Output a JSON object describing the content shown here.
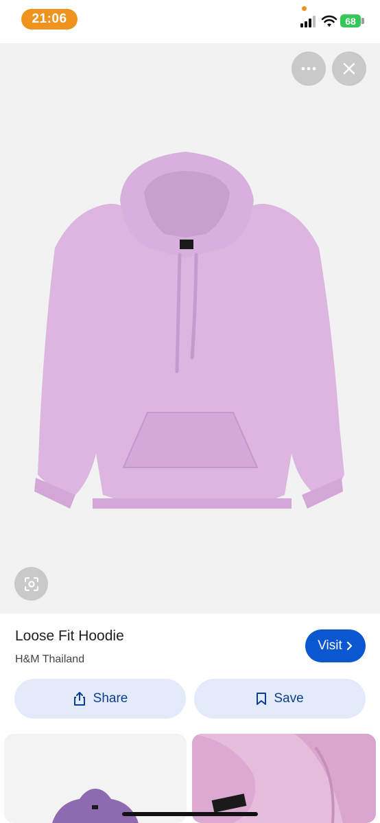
{
  "status_bar": {
    "time": "21:06",
    "battery": "68",
    "icons": [
      "signal-icon",
      "wifi-icon",
      "battery-icon"
    ]
  },
  "viewer": {
    "buttons": [
      "more-icon",
      "close-icon",
      "lens-icon"
    ]
  },
  "product": {
    "title": "Loose Fit Hoodie",
    "source": "H&M Thailand",
    "visit_label": "Visit",
    "share_label": "Share",
    "save_label": "Save"
  },
  "colors": {
    "accent": "#0b57d0",
    "pill_bg": "#e3ebfb",
    "hoodie": "#dcb6e0",
    "status_pill": "#f0931e"
  }
}
